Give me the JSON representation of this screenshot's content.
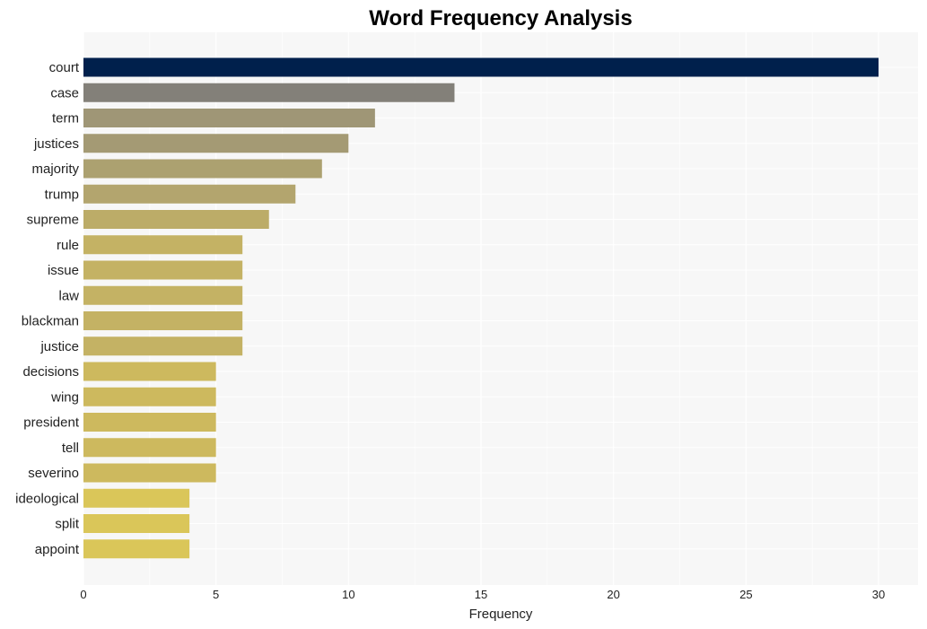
{
  "chart_data": {
    "type": "bar",
    "orientation": "horizontal",
    "title": "Word Frequency Analysis",
    "xlabel": "Frequency",
    "ylabel": "",
    "xlim": [
      0,
      31.5
    ],
    "xticks": [
      0,
      5,
      10,
      15,
      20,
      25,
      30
    ],
    "grid": true,
    "legend": "none",
    "categories": [
      "court",
      "case",
      "term",
      "justices",
      "majority",
      "trump",
      "supreme",
      "rule",
      "issue",
      "law",
      "blackman",
      "justice",
      "decisions",
      "wing",
      "president",
      "tell",
      "severino",
      "ideological",
      "split",
      "appoint"
    ],
    "values": [
      30,
      14,
      11,
      10,
      9,
      8,
      7,
      6,
      6,
      6,
      6,
      6,
      5,
      5,
      5,
      5,
      5,
      4,
      4,
      4
    ],
    "colors": [
      "#00204c",
      "#838079",
      "#9f9676",
      "#a49a74",
      "#aca170",
      "#b3a56e",
      "#bcac68",
      "#c4b264",
      "#c4b264",
      "#c4b264",
      "#c4b264",
      "#c4b264",
      "#cdb95e",
      "#cdb95e",
      "#cdb95e",
      "#cdb95e",
      "#cdb95e",
      "#dac659",
      "#dac659",
      "#dac659"
    ]
  }
}
